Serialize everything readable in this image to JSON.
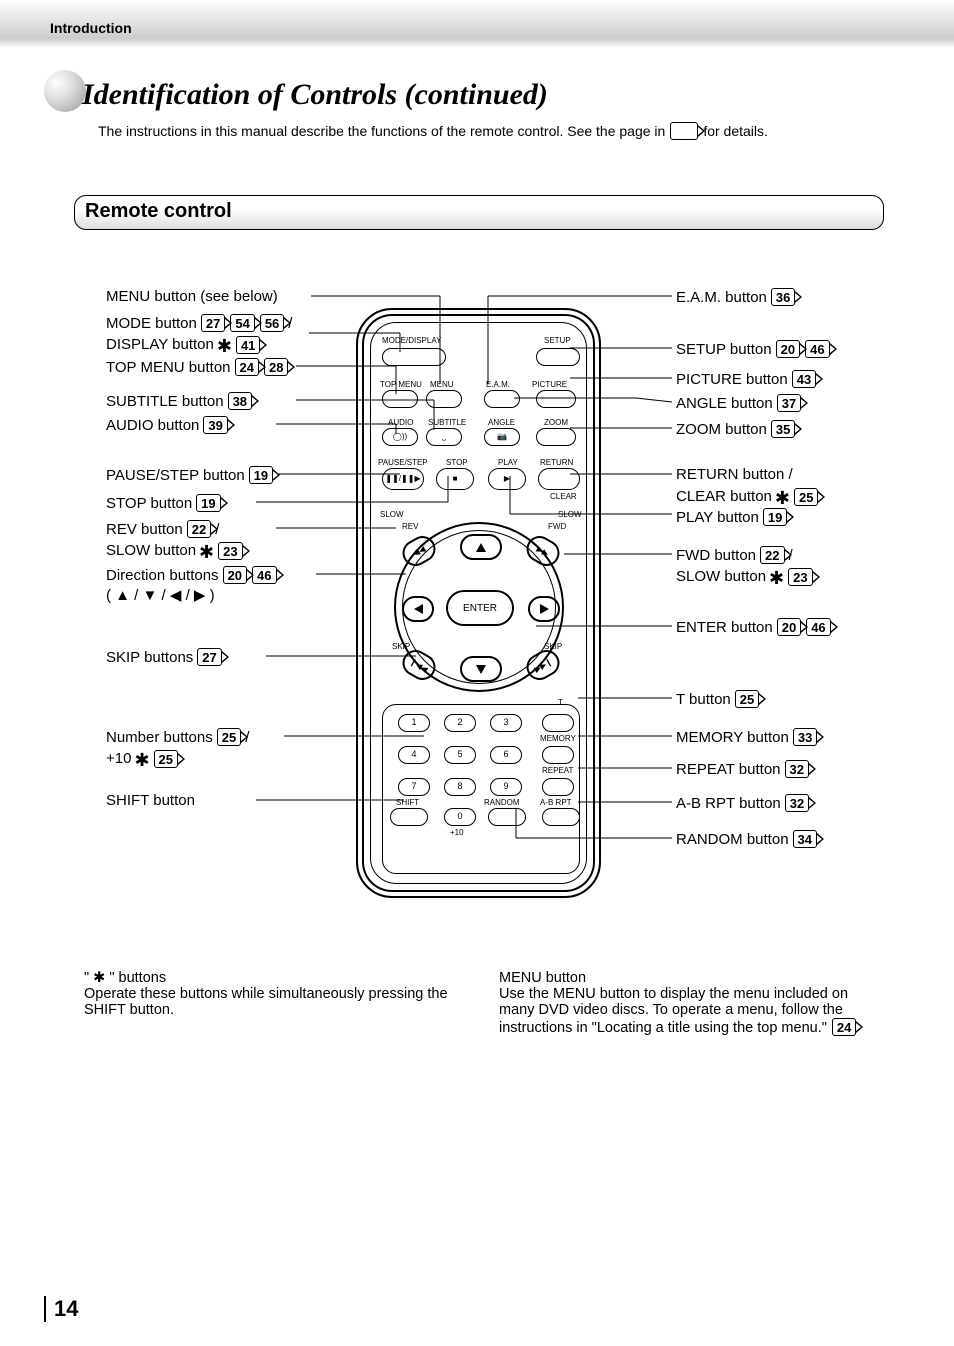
{
  "section": "Introduction",
  "title": "Identification of Controls (continued)",
  "intro_before": "The instructions in this manual describe the functions of the remote control. See the page in",
  "intro_after": "for details.",
  "subsection": "Remote control",
  "callouts_left": [
    {
      "text": "MENU button (see below)",
      "ref": []
    },
    {
      "text": "MODE button",
      "ref": [
        "27",
        "54",
        "56"
      ],
      "tail": " /"
    },
    {
      "text": "DISPLAY button",
      "star": true,
      "ref": [
        "41"
      ]
    },
    {
      "text": "TOP MENU button",
      "ref": [
        "24",
        "28"
      ]
    },
    {
      "text": "SUBTITLE button",
      "ref": [
        "38"
      ]
    },
    {
      "text": "AUDIO button",
      "ref": [
        "39"
      ]
    },
    {
      "text": "PAUSE/STEP button",
      "ref": [
        "19"
      ]
    },
    {
      "text": "STOP button",
      "ref": [
        "19"
      ]
    },
    {
      "text": "REV button",
      "ref": [
        "22"
      ],
      "tail": "/"
    },
    {
      "text": "SLOW button",
      "star": true,
      "ref": [
        "23"
      ]
    },
    {
      "text": "Direction buttons",
      "ref": [
        "20",
        "46"
      ]
    },
    {
      "text_plain": "( ▲ / ▼ / ◀ / ▶ )"
    },
    {
      "text": "SKIP buttons",
      "ref": [
        "27"
      ]
    },
    {
      "text": "Number buttons",
      "ref": [
        "25"
      ],
      "tail": "/"
    },
    {
      "text": "+10",
      "star": true,
      "ref": [
        "25"
      ]
    },
    {
      "text": "SHIFT button",
      "ref": []
    }
  ],
  "callouts_right": [
    {
      "text": "E.A.M. button",
      "ref": [
        "36"
      ]
    },
    {
      "text": "SETUP button",
      "ref": [
        "20",
        "46"
      ]
    },
    {
      "text": "PICTURE button",
      "ref": [
        "43"
      ]
    },
    {
      "text": "ANGLE button",
      "ref": [
        "37"
      ]
    },
    {
      "text": "ZOOM button",
      "ref": [
        "35"
      ]
    },
    {
      "text": "RETURN button /",
      "ref": []
    },
    {
      "text": "CLEAR button",
      "star": true,
      "ref": [
        "25"
      ]
    },
    {
      "text": "PLAY button",
      "ref": [
        "19"
      ]
    },
    {
      "text": "FWD button",
      "ref": [
        "22"
      ],
      "tail": " /"
    },
    {
      "text": "SLOW button",
      "star": true,
      "ref": [
        "23"
      ]
    },
    {
      "text": "ENTER button",
      "ref": [
        "20",
        "46"
      ]
    },
    {
      "text": "T button",
      "ref": [
        "25"
      ]
    },
    {
      "text": "MEMORY button",
      "ref": [
        "33"
      ]
    },
    {
      "text": "REPEAT button",
      "ref": [
        "32"
      ]
    },
    {
      "text": "A-B RPT button",
      "ref": [
        "32"
      ]
    },
    {
      "text": "RANDOM button",
      "ref": [
        "34"
      ]
    }
  ],
  "remote_labels": {
    "mode_display": "MODE/DISPLAY",
    "setup": "SETUP",
    "top_menu": "TOP MENU",
    "menu": "MENU",
    "eam": "E.A.M.",
    "picture": "PICTURE",
    "audio": "AUDIO",
    "subtitle": "SUBTITLE",
    "angle": "ANGLE",
    "zoom": "ZOOM",
    "pause_step": "PAUSE/STEP",
    "stop": "STOP",
    "play": "PLAY",
    "return": "RETURN",
    "clear": "CLEAR",
    "slow": "SLOW",
    "rev": "REV",
    "fwd": "FWD",
    "enter": "ENTER",
    "skip": "SKIP",
    "t": "T",
    "memory": "MEMORY",
    "repeat": "REPEAT",
    "shift": "SHIFT",
    "random": "RANDOM",
    "abrpt": "A-B RPT",
    "plus10": "+10",
    "nums": [
      "1",
      "2",
      "3",
      "4",
      "5",
      "6",
      "7",
      "8",
      "9",
      "0"
    ]
  },
  "footnote_left_title": "\" ✱ \" buttons",
  "footnote_left_body": "Operate these buttons while simultaneously pressing the SHIFT button.",
  "footnote_right_title": "MENU button",
  "footnote_right_body": "Use the MENU button to display the menu included on many DVD video discs. To operate a menu, follow the instructions in \"Locating a title using the top menu.\"",
  "footnote_right_ref": "24",
  "pagenum": "14"
}
